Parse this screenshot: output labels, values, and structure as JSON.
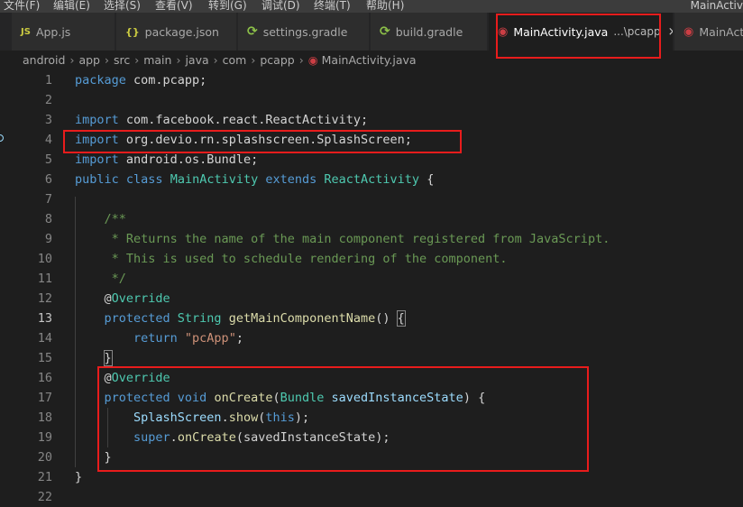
{
  "menubar": {
    "items": [
      "文件(F)",
      "编辑(E)",
      "选择(S)",
      "查看(V)",
      "转到(G)",
      "调试(D)",
      "终端(T)",
      "帮助(H)"
    ],
    "window_title": "MainActiv"
  },
  "tabs": [
    {
      "label": "App.js",
      "icon": "JS"
    },
    {
      "label": "package.json",
      "icon": "{}"
    },
    {
      "label": "settings.gradle",
      "icon": "gradle-icon"
    },
    {
      "label": "build.gradle",
      "icon": "gradle-icon"
    },
    {
      "label": "MainActivity.java",
      "description": "...\\pcapp",
      "icon": "java-icon",
      "active": true,
      "close": "×"
    },
    {
      "label": "MainActiv",
      "icon": "java-icon"
    }
  ],
  "breadcrumb": [
    "android",
    "app",
    "src",
    "main",
    "java",
    "com",
    "pcapp",
    "MainActivity.java"
  ],
  "editor": {
    "current_line": 13,
    "line_numbers": [
      "1",
      "2",
      "3",
      "4",
      "5",
      "6",
      "7",
      "8",
      "9",
      "10",
      "11",
      "12",
      "13",
      "14",
      "15",
      "16",
      "17",
      "18",
      "19",
      "20",
      "21",
      "22"
    ],
    "lines": [
      [
        {
          "t": "package ",
          "c": "k"
        },
        {
          "t": "com.pcapp;",
          "c": "p"
        }
      ],
      [],
      [
        {
          "t": "import ",
          "c": "k"
        },
        {
          "t": "com.facebook.react.ReactActivity;",
          "c": "p"
        }
      ],
      [
        {
          "t": "import ",
          "c": "k"
        },
        {
          "t": "org.devio.rn.splashscreen.SplashScreen;",
          "c": "p"
        }
      ],
      [
        {
          "t": "import ",
          "c": "k"
        },
        {
          "t": "android.os.Bundle;",
          "c": "p"
        }
      ],
      [
        {
          "t": "public ",
          "c": "k"
        },
        {
          "t": "class ",
          "c": "k"
        },
        {
          "t": "MainActivity ",
          "c": "t"
        },
        {
          "t": "extends ",
          "c": "k"
        },
        {
          "t": "ReactActivity ",
          "c": "t"
        },
        {
          "t": "{",
          "c": "p"
        }
      ],
      [],
      [
        {
          "t": "    /**",
          "c": "c"
        }
      ],
      [
        {
          "t": "     * Returns the name of the main component registered from JavaScript.",
          "c": "c"
        }
      ],
      [
        {
          "t": "     * This is used to schedule rendering of the component.",
          "c": "c"
        }
      ],
      [
        {
          "t": "     */",
          "c": "c"
        }
      ],
      [
        {
          "t": "    @",
          "c": "p"
        },
        {
          "t": "Override",
          "c": "t"
        }
      ],
      [
        {
          "t": "    protected ",
          "c": "k"
        },
        {
          "t": "String ",
          "c": "t"
        },
        {
          "t": "getMainComponentName",
          "c": "f"
        },
        {
          "t": "() ",
          "c": "p"
        },
        {
          "t": "{",
          "c": "p",
          "hl": true
        }
      ],
      [
        {
          "t": "        return ",
          "c": "k"
        },
        {
          "t": "\"pcApp\"",
          "c": "s"
        },
        {
          "t": ";",
          "c": "p"
        }
      ],
      [
        {
          "t": "    ",
          "c": "p"
        },
        {
          "t": "}",
          "c": "p",
          "hl": true
        }
      ],
      [
        {
          "t": "    @",
          "c": "p"
        },
        {
          "t": "Override",
          "c": "t"
        }
      ],
      [
        {
          "t": "    protected ",
          "c": "k"
        },
        {
          "t": "void ",
          "c": "k"
        },
        {
          "t": "onCreate",
          "c": "f"
        },
        {
          "t": "(",
          "c": "p"
        },
        {
          "t": "Bundle ",
          "c": "t"
        },
        {
          "t": "savedInstanceState",
          "c": "v"
        },
        {
          "t": ") {",
          "c": "p"
        }
      ],
      [
        {
          "t": "        SplashScreen",
          "c": "v"
        },
        {
          "t": ".",
          "c": "p"
        },
        {
          "t": "show",
          "c": "f"
        },
        {
          "t": "(",
          "c": "p"
        },
        {
          "t": "this",
          "c": "k"
        },
        {
          "t": ");",
          "c": "p"
        }
      ],
      [
        {
          "t": "        super",
          "c": "k"
        },
        {
          "t": ".",
          "c": "p"
        },
        {
          "t": "onCreate",
          "c": "f"
        },
        {
          "t": "(savedInstanceState);",
          "c": "p"
        }
      ],
      [
        {
          "t": "    }",
          "c": "p"
        }
      ],
      [
        {
          "t": "}",
          "c": "p"
        }
      ],
      []
    ]
  },
  "colors": {
    "annotation_box": "#e81c1c",
    "keyword": "#569cd6",
    "type": "#4ec9b0",
    "function": "#dcdcaa",
    "string": "#ce9178",
    "comment": "#6a9955",
    "variable": "#9cdcfe"
  }
}
